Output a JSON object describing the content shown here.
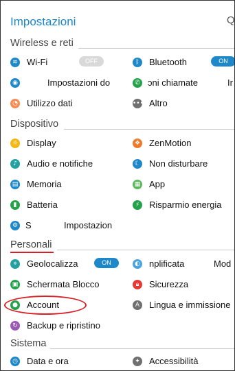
{
  "header": {
    "title": "Impostazioni",
    "search_cut": "Q"
  },
  "colors": {
    "accent": "#1e88c9",
    "annotation": "#d81f26"
  },
  "sections": {
    "wireless": "Wireless e reti",
    "device": "Dispositivo",
    "personal": "Personali",
    "system": "Sistema"
  },
  "items": {
    "wifi": "Wi-Fi",
    "wifi_toggle": "OFF",
    "bluetooth": "Bluetooth",
    "bluetooth_toggle": "ON",
    "impostazioni_do": "Impostazioni do",
    "chiamate": "ɔni chiamate",
    "chiamate_cut": "Ir",
    "utilizzo": "Utilizzo dati",
    "altro": "Altro",
    "display": "Display",
    "zenmotion": "ZenMotion",
    "audio": "Audio e notifiche",
    "non_disturbare": "Non disturbare",
    "memoria": "Memoria",
    "app": "App",
    "batteria": "Batteria",
    "risparmio": "Risparmio energia",
    "s": "S",
    "impostazion": "Impostazion",
    "geolocalizza": "Geolocalizza",
    "geo_toggle": "ON",
    "semplificata": "nplificata",
    "mod": "Mod",
    "schermata": "Schermata Blocco",
    "sicurezza": "Sicurezza",
    "account": "Account",
    "lingua": "Lingua e immissione",
    "backup": "Backup e ripristino",
    "data_ora": "Data e ora",
    "accessibilita": "Accessibilità"
  }
}
